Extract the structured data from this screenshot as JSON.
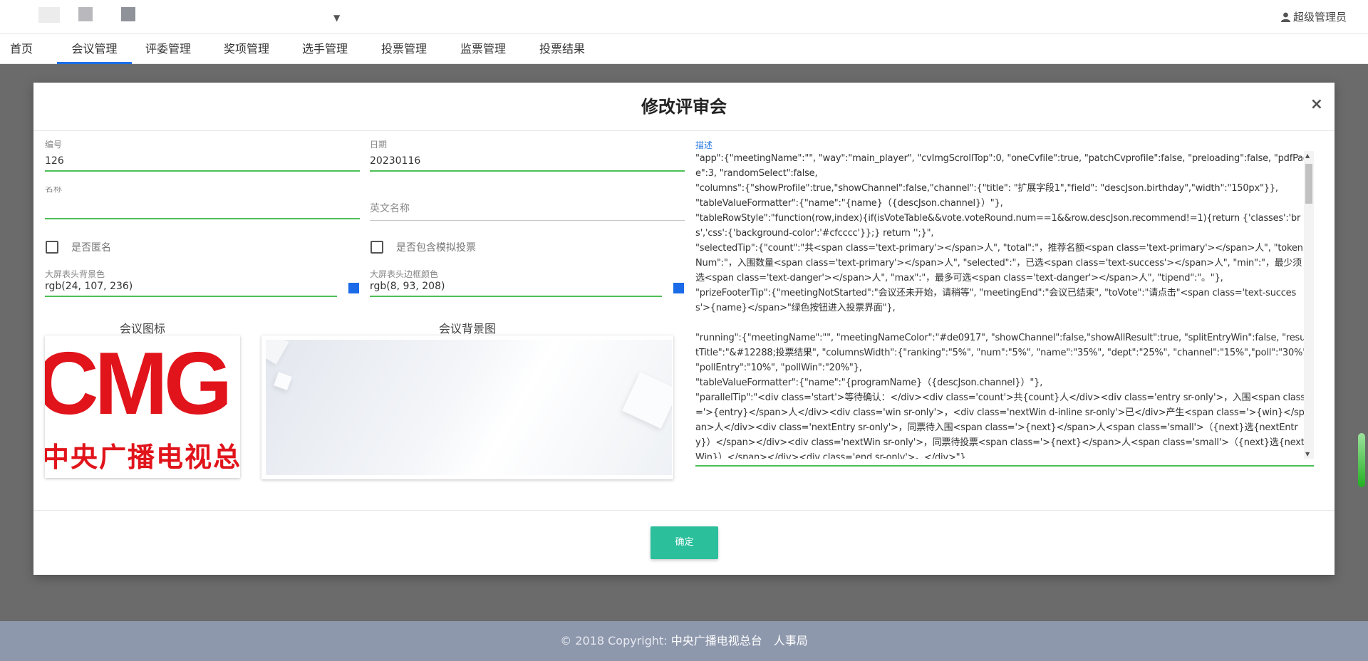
{
  "header": {
    "user_name": "超级管理员",
    "user_icon": "user-icon",
    "dropdown_icon": "▼"
  },
  "nav": {
    "items": [
      {
        "label": "首页"
      },
      {
        "label": "会议管理",
        "active": true
      },
      {
        "label": "评委管理"
      },
      {
        "label": "奖项管理"
      },
      {
        "label": "选手管理"
      },
      {
        "label": "投票管理"
      },
      {
        "label": "监票管理"
      },
      {
        "label": "投票结果"
      }
    ]
  },
  "modal": {
    "title": "修改评审会",
    "close": "×",
    "fields": {
      "id": {
        "label": "编号",
        "value": "126"
      },
      "date": {
        "label": "日期",
        "value": "20230116"
      },
      "name": {
        "label": "名称",
        "value": ""
      },
      "english_name": {
        "placeholder": "英文名称"
      },
      "anonymous": {
        "label": "是否匿名",
        "checked": false
      },
      "mock_vote": {
        "label": "是否包含模拟投票",
        "checked": false
      },
      "header_bg_color": {
        "label": "大屏表头背景色",
        "value": "rgb(24, 107, 236)"
      },
      "header_border_color": {
        "label": "大屏表头边框颜色",
        "value": "rgb(8, 93, 208)"
      }
    },
    "images": {
      "icon_title": "会议图标",
      "icon_logo_latin": "CMG",
      "icon_logo_cn": "中央广播电视总",
      "background_title": "会议背景图"
    },
    "description": {
      "label": "描述",
      "text": "\"app\":{\"meetingName\":\"\", \"way\":\"main_player\", \"cvImgScrollTop\":0, \"oneCvfile\":true, \"patchCvprofile\":false, \"preloading\":false, \"pdfPage\":3, \"randomSelect\":false,\n\"columns\":{\"showProfile\":true,\"showChannel\":false,\"channel\":{\"title\": \"扩展字段1\",\"field\": \"descJson.birthday\",\"width\":\"150px\"}},\n\"tableValueFormatter\":{\"name\":\"{name}（{descJson.channel}）\"},\n\"tableRowStyle\":\"function(row,index){if(isVoteTable&&vote.voteRound.num==1&&row.descJson.recommend!=1){return {'classes':'brs','css':{'background-color':'#cfcccc'}};} return '';}\",\n\"selectedTip\":{\"count\":\"共<span class='text-primary'></span>人\", \"total\":\"，推荐名额<span class='text-primary'></span>人\", \"tokenNum\":\"，入围数量<span class='text-primary'></span>人\", \"selected\":\"，已选<span class='text-success'></span>人\", \"min\":\"，最少须选<span class='text-danger'></span>人\", \"max\":\"，最多可选<span class='text-danger'></span>人\", \"tipend\":\"。\"},\n\"prizeFooterTip\":{\"meetingNotStarted\":\"会议还未开始，请稍等\", \"meetingEnd\":\"会议已结束\", \"toVote\":\"请点击\"<span class='text-success'>{name}</span>\"绿色按钮进入投票界面\"},\n\n\"running\":{\"meetingName\":\"\", \"meetingNameColor\":\"#de0917\", \"showChannel\":false,\"showAllResult\":true, \"splitEntryWin\":false, \"resultTitle\":\"&#12288;投票结果\", \"columnsWidth\":{\"ranking\":\"5%\", \"num\":\"5%\", \"name\":\"35%\", \"dept\":\"25%\", \"channel\":\"15%\",\"poll\":\"30%\", \"pollEntry\":\"10%\", \"pollWin\":\"20%\"},\n\"tableValueFormatter\":{\"name\":\"{programName}（{descJson.channel}）\"},\n\"parallelTip\":\"<div class='start'>等待确认：</div><div class='count'>共{count}人</div><div class='entry sr-only'>，入围<span class='>{entry}</span>人</div><div class='win sr-only'>，<div class='nextWin d-inline sr-only'>已</div>产生<span class='>{win}</span>人</div><div class='nextEntry sr-only'>，同票待入围<span class='>{next}</span>人<span class='small'>（{next}选{nextEntry}）</span></div><div class='nextWin sr-only'>，同票待投票<span class='>{next}</span>人<span class='small'>（{next}选{nextWin}）</span></div><div class='end sr-only'>。</div>\"}"
    },
    "ok_button": "确定"
  },
  "footer": {
    "copyright": "© 2018 Copyright: ",
    "org": "中央广播电视总台　人事局"
  },
  "colors": {
    "accent": "#1b6fe6",
    "input_underline": "#4cbf55",
    "ok_button": "#2bbf9c",
    "swatch": "#1b6be8",
    "logo_red": "#e1141b"
  }
}
